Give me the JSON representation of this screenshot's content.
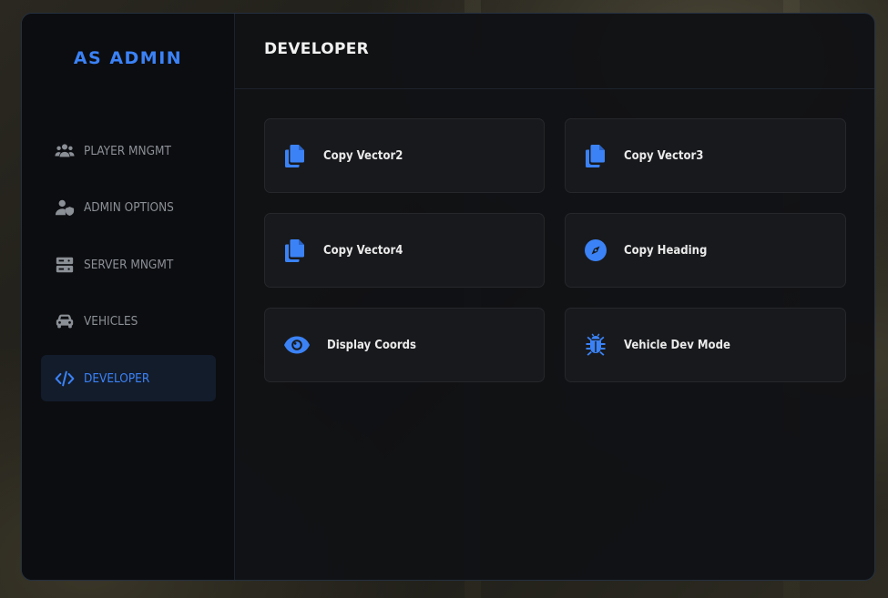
{
  "brand": {
    "title": "AS ADMIN"
  },
  "sidebar": {
    "items": [
      {
        "label": "PLAYER MNGMT",
        "icon": "users-icon",
        "active": false
      },
      {
        "label": "ADMIN OPTIONS",
        "icon": "user-shield-icon",
        "active": false
      },
      {
        "label": "SERVER MNGMT",
        "icon": "server-icon",
        "active": false
      },
      {
        "label": "VEHICLES",
        "icon": "car-icon",
        "active": false
      },
      {
        "label": "DEVELOPER",
        "icon": "code-icon",
        "active": true
      }
    ]
  },
  "main": {
    "title": "DEVELOPER",
    "actions": [
      {
        "label": "Copy Vector2",
        "icon": "copy-icon"
      },
      {
        "label": "Copy Vector3",
        "icon": "copy-icon"
      },
      {
        "label": "Copy Vector4",
        "icon": "copy-icon"
      },
      {
        "label": "Copy Heading",
        "icon": "compass-icon"
      },
      {
        "label": "Display Coords",
        "icon": "eye-icon"
      },
      {
        "label": "Vehicle Dev Mode",
        "icon": "bug-icon"
      }
    ]
  },
  "colors": {
    "accent": "#3b82f6",
    "panel_bg": "#111215",
    "sidebar_bg": "#0c0d10",
    "card_bg": "#18191c",
    "text_muted": "#8b8f96"
  }
}
